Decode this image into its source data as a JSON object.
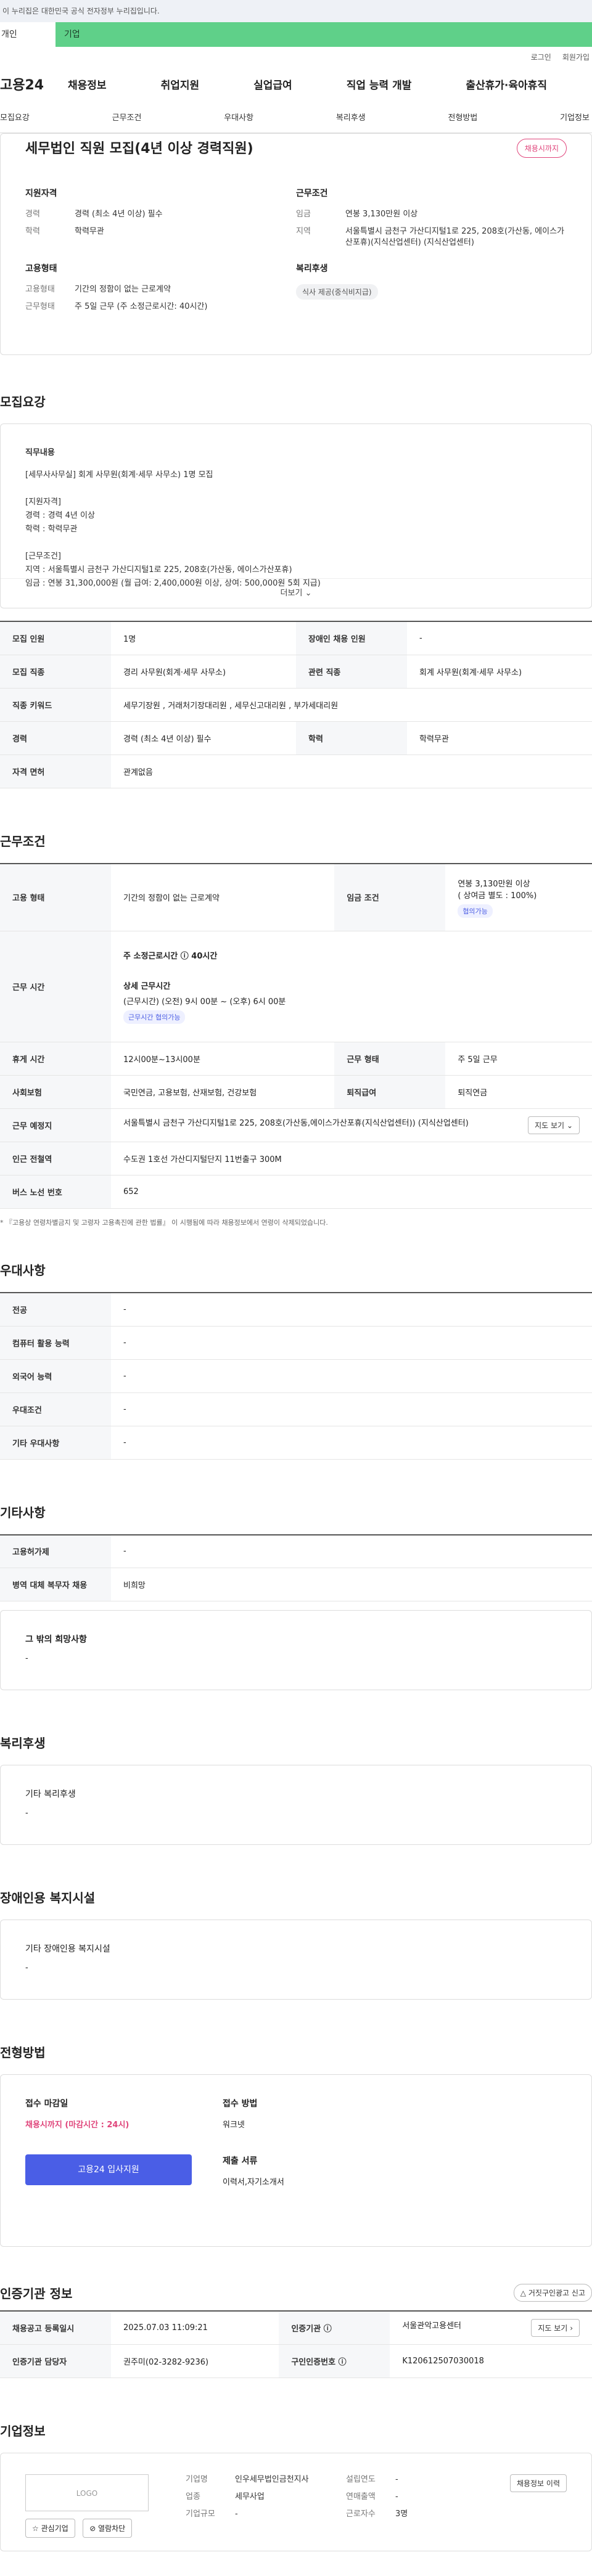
{
  "gov": "이 누리집은 대한민국 공식 전자정부 누리집입니다.",
  "tabs": [
    "개인",
    "기업"
  ],
  "util": [
    "로그인",
    "회원가입"
  ],
  "logo": "고용24",
  "gnb": [
    "채용정보",
    "취업지원",
    "실업급여",
    "직업 능력 개발",
    "출산휴가·육아휴직"
  ],
  "subnav": [
    "모집요강",
    "근무조건",
    "우대사항",
    "복리후생",
    "전형방법",
    "기업정보"
  ],
  "summary": {
    "title": "세무법인 직원 모집(4년 이상 경력직원)",
    "badge": "채용시까지",
    "qual_title": "지원자격",
    "career_k": "경력",
    "career_v": "경력 (최소 4년 이상) 필수",
    "edu_k": "학력",
    "edu_v": "학력무관",
    "emp_title": "고용형태",
    "emptype_k": "고용형태",
    "emptype_v": "기간의 정함이 없는 근로계약",
    "work_k": "근무형태",
    "work_v": "주 5일 근무 (주 소정근로시간: 40시간)",
    "cond_title": "근무조건",
    "wage_k": "임금",
    "wage_v": "연봉 3,130만원 이상",
    "area_k": "지역",
    "area_v": "서울특별시 금천구 가산디지털1로 225, 208호(가산동, 에이스가산포휴)(지식산업센터) (지식산업센터)",
    "welfare_title": "복리후생",
    "welfare_tag": "식사 제공(중식비지급)"
  },
  "recruit": {
    "title": "모집요강",
    "desc_title": "직무내용",
    "desc_lines": [
      "[세무사사무실] 회계 사무원(회계·세무 사무소) 1명 모집",
      "",
      "[지원자격]",
      "경력 : 경력 4년 이상",
      "학력 : 학력무관",
      "",
      "[근무조건]",
      "지역 : 서울특별시 금천구 가산디지털1로 225, 208호(가산동, 에이스가산포휴)",
      "임금 : 연봉 31,300,000원 (월 급여: 2,400,000원 이상, 상여: 500,000원  5회 지급)"
    ],
    "more": "더보기",
    "rows": [
      [
        "모집 인원",
        "1명",
        "장애인 채용 인원",
        "-"
      ],
      [
        "모집 직종",
        "경리 사무원(회계·세무 사무소)",
        "관련 직종",
        "회계 사무원(회계·세무 사무소)"
      ],
      [
        "직종 키워드",
        "세무기장원 , 거래처기장대리원 , 세무신고대리원 , 부가세대리원",
        "",
        ""
      ],
      [
        "경력",
        "경력 (최소 4년 이상) 필수",
        "학력",
        "학력무관"
      ],
      [
        "자격 면허",
        "관계없음",
        "",
        ""
      ]
    ]
  },
  "workcond": {
    "title": "근무조건",
    "emp_h": "고용 형태",
    "emp_v": "기간의 정함이 없는 근로계약",
    "wage_h": "임금 조건",
    "wage_v1": "연봉 3,130만원 이상",
    "wage_v2": "( 상여금 별도 : 100%)",
    "wage_chip": "협의가능",
    "time_h": "근무 시간",
    "time_weekly": "주 소정근로시간 ⓘ 40시간",
    "time_detail_t": "상세 근무시간",
    "time_detail_v": "(근무시간) (오전) 9시 00분 ~ (오후) 6시 00분",
    "time_chip": "근무시간 협의가능",
    "rest_h": "휴게 시간",
    "rest_v": "12시00분~13시00분",
    "form_h": "근무 형태",
    "form_v": "주 5일 근무",
    "ins_h": "사회보험",
    "ins_v": "국민연금, 고용보험, 산재보험, 건강보험",
    "ret_h": "퇴직급여",
    "ret_v": "퇴직연금",
    "loc_h": "근무 예정지",
    "loc_v": "서울특별시 금천구 가산디지털1로 225, 208호(가산동,에이스가산포휴(지식산업센터)) (지식산업센터)",
    "map_btn": "지도 보기",
    "sub_h": "인근 전철역",
    "sub_v": "수도권 1호선 가산디지털단지 11번출구 300M",
    "bus_h": "버스 노선 번호",
    "bus_v": "652",
    "note": "* 『고용상 연령차별금지 및 고령자 고용촉진에 관한 법률』 이 시행됨에 따라 채용정보에서 연령이 삭제되었습니다."
  },
  "pref": {
    "title": "우대사항",
    "rows": [
      [
        "전공",
        "-"
      ],
      [
        "컴퓨터 활용 능력",
        "-"
      ],
      [
        "외국어 능력",
        "-"
      ],
      [
        "우대조건",
        "-"
      ],
      [
        "기타 우대사항",
        "-"
      ]
    ]
  },
  "etc": {
    "title": "기타사항",
    "rows": [
      [
        "고용허가제",
        "-"
      ],
      [
        "병역 대체 복무자 채용",
        "비희망"
      ]
    ],
    "other_t": "그 밖의 희망사항",
    "other_v": "-"
  },
  "welfare": {
    "title": "복리후생",
    "sub": "기타 복리후생",
    "v": "-"
  },
  "disability": {
    "title": "장애인용 복지시설",
    "sub": "기타 장애인용 복지시설",
    "v": "-"
  },
  "apply": {
    "title": "전형방법",
    "deadline_t": "접수 마감일",
    "deadline_v": "채용시까지 (마감시간 : 24시)",
    "btn": "고용24 입사지원",
    "method_t": "접수 방법",
    "method_v": "워크넷",
    "docs_t": "제출 서류",
    "docs_v": "이력서,자기소개서"
  },
  "agency": {
    "title": "인증기관 정보",
    "report_btn": "거짓구인광고 신고",
    "reg_h": "채용공고 등록일시",
    "reg_v": "2025.07.03 11:09:21",
    "org_h": "인증기관 ⓘ",
    "org_v": "서울관악고용센터",
    "map_btn": "지도 보기",
    "mgr_h": "인증기관 담당자",
    "mgr_v": "권주미(02-3282-9236)",
    "no_h": "구인인증번호 ⓘ",
    "no_v": "K120612507030018"
  },
  "company": {
    "title": "기업정보",
    "logo": "LOGO",
    "fav": "☆ 관심기업",
    "block": "⊘ 열람차단",
    "name_k": "기업명",
    "name_v": "인우세무법인금천지사",
    "ind_k": "업종",
    "ind_v": "세무사업",
    "size_k": "기업규모",
    "size_v": "-",
    "est_k": "설립연도",
    "est_v": "-",
    "sales_k": "연매출액",
    "sales_v": "-",
    "emp_k": "근로자수",
    "emp_v": "3명",
    "history_btn": "채용정보 이력"
  }
}
